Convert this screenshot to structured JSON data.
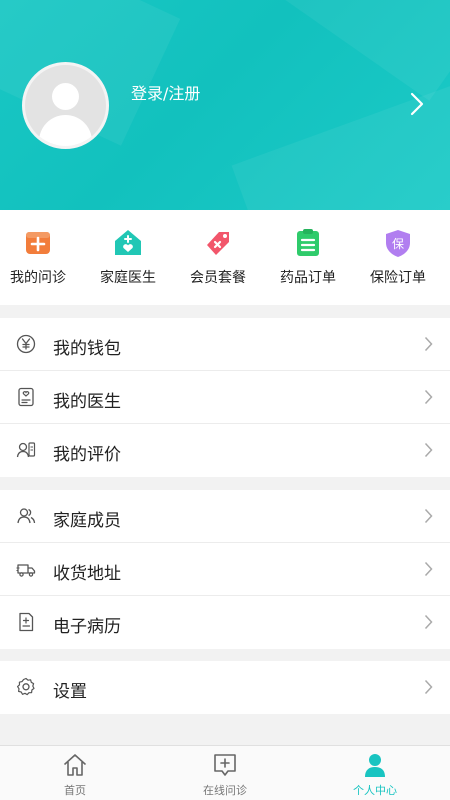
{
  "profile": {
    "login_label": "登录/注册",
    "avatar_icon": "default-avatar-icon",
    "arrow_icon": "chevron-right-icon"
  },
  "quick_actions": [
    {
      "label": "我的问诊",
      "icon": "plus-square-icon",
      "color": "#f27d3b"
    },
    {
      "label": "家庭医生",
      "icon": "house-heart-icon",
      "color": "#21c7b5"
    },
    {
      "label": "会员套餐",
      "icon": "tag-icon",
      "color": "#f2566b"
    },
    {
      "label": "药品订单",
      "icon": "clipboard-list-icon",
      "color": "#2fcb6b"
    },
    {
      "label": "保险订单",
      "icon": "shield-icon",
      "color": "#b17ef0",
      "badge_text": "保"
    }
  ],
  "menu_groups": [
    [
      {
        "label": "我的钱包",
        "icon": "yen-coin-icon"
      },
      {
        "label": "我的医生",
        "icon": "doctor-card-icon"
      },
      {
        "label": "我的评价",
        "icon": "review-user-icon"
      }
    ],
    [
      {
        "label": "家庭成员",
        "icon": "family-members-icon"
      },
      {
        "label": "收货地址",
        "icon": "delivery-truck-icon"
      },
      {
        "label": "电子病历",
        "icon": "medical-record-icon"
      }
    ],
    [
      {
        "label": "设置",
        "icon": "gear-icon"
      }
    ]
  ],
  "tabbar": [
    {
      "label": "首页",
      "icon": "home-icon",
      "active": false
    },
    {
      "label": "在线问诊",
      "icon": "consult-chat-icon",
      "active": false
    },
    {
      "label": "个人中心",
      "icon": "person-icon",
      "active": true
    }
  ],
  "colors": {
    "accent": "#19c4c1",
    "header_bg": "#16c4c1",
    "text": "#222222",
    "inactive_tab": "#777777"
  }
}
